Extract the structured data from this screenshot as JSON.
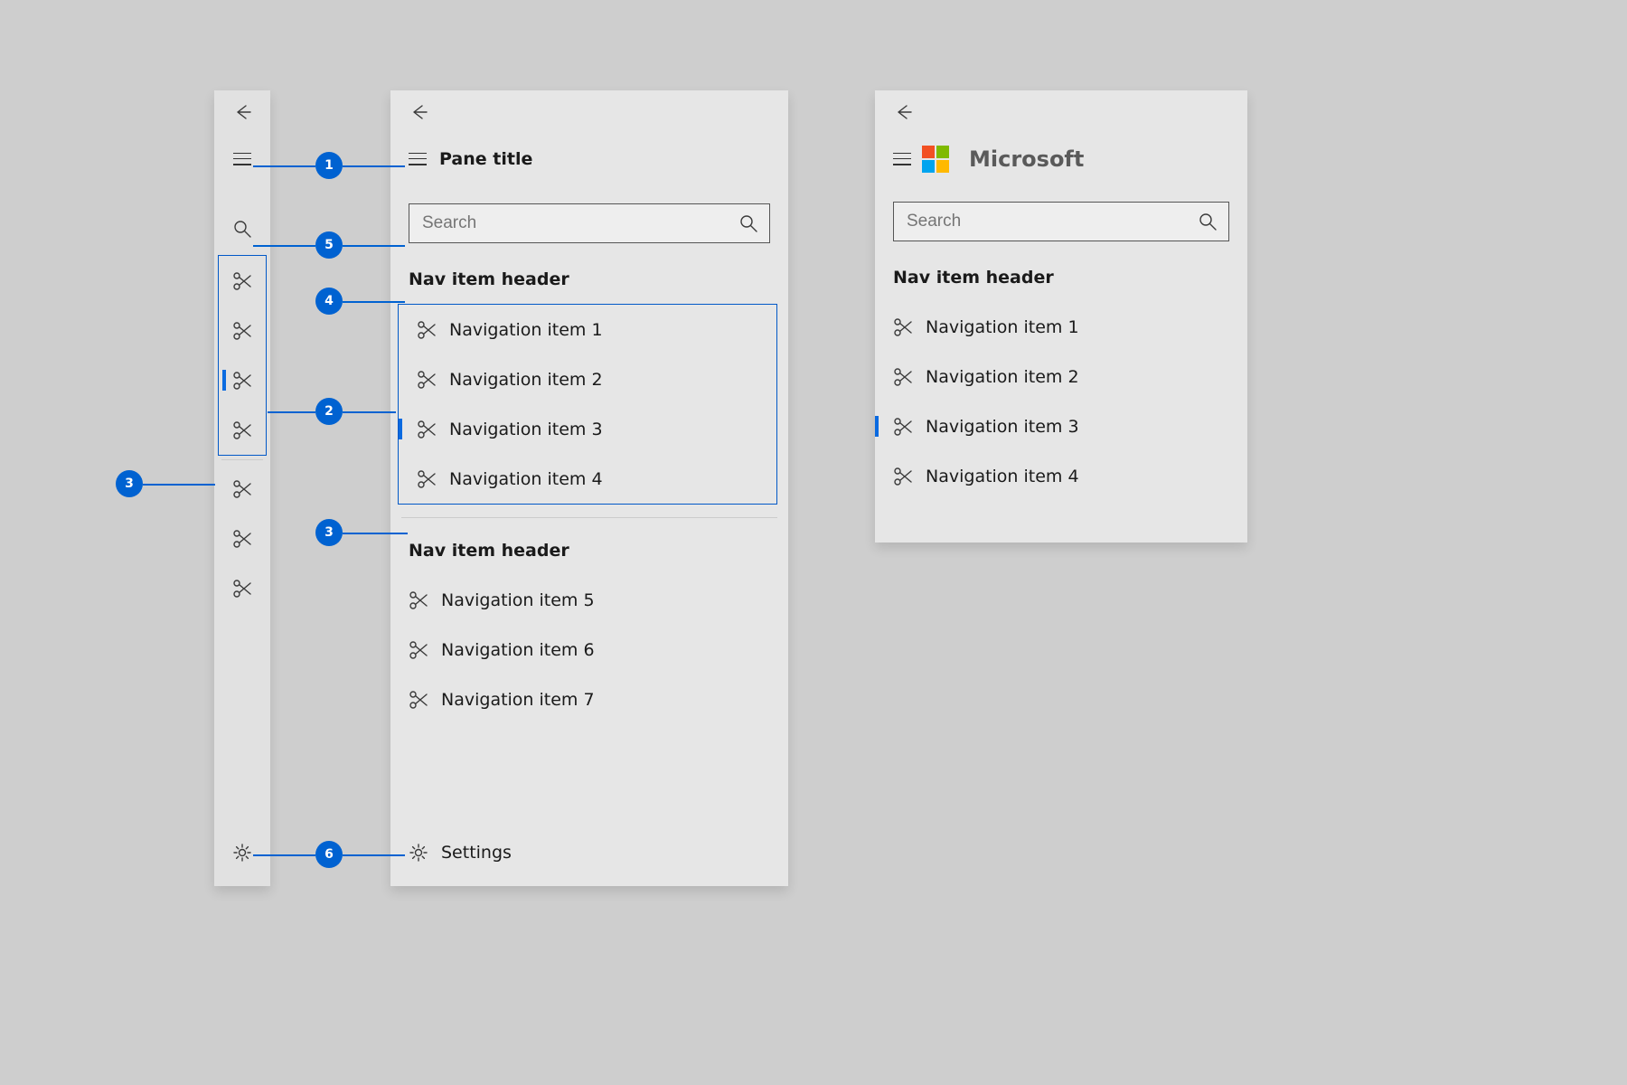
{
  "expanded": {
    "pane_title": "Pane title",
    "search_placeholder": "Search",
    "group1_header": "Nav item header",
    "group1_items": [
      "Navigation item 1",
      "Navigation item 2",
      "Navigation item 3",
      "Navigation item 4"
    ],
    "group1_selected_index": 2,
    "group2_header": "Nav item header",
    "group2_items": [
      "Navigation item 5",
      "Navigation item 6",
      "Navigation item 7"
    ],
    "settings_label": "Settings"
  },
  "compact": {
    "group1_count": 4,
    "selected_index": 2,
    "group2_count": 3
  },
  "branded": {
    "brand_name": "Microsoft",
    "logo_colors": {
      "tl": "#f25022",
      "tr": "#7fba00",
      "bl": "#00a4ef",
      "br": "#ffb900"
    },
    "search_placeholder": "Search",
    "group_header": "Nav item header",
    "items": [
      "Navigation item 1",
      "Navigation item 2",
      "Navigation item 3",
      "Navigation item 4"
    ],
    "selected_index": 2
  },
  "callouts": {
    "1": "1",
    "2": "2",
    "3": "3",
    "4": "4",
    "5": "5",
    "6": "6"
  },
  "colors": {
    "accent": "#0062d1",
    "box": "#0158c7",
    "selection": "#0a6ae0"
  }
}
